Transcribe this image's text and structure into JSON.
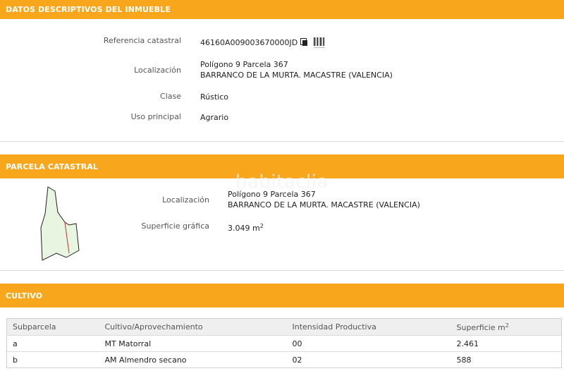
{
  "sections": {
    "descriptive": {
      "title": "DATOS DESCRIPTIVOS DEL INMUEBLE",
      "ref_label": "Referencia catastral",
      "ref_value": "46160A009003670000JD",
      "loc_label": "Localización",
      "loc_line1": "Polígono 9 Parcela 367",
      "loc_line2": "BARRANCO DE LA MURTA. MACASTRE (VALENCIA)",
      "clase_label": "Clase",
      "clase_value": "Rústico",
      "uso_label": "Uso principal",
      "uso_value": "Agrario"
    },
    "parcela": {
      "title": "PARCELA CATASTRAL",
      "loc_label": "Localización",
      "loc_line1": "Polígono 9 Parcela 367",
      "loc_line2": "BARRANCO DE LA MURTA. MACASTRE (VALENCIA)",
      "sup_label": "Superficie gráfica",
      "sup_value": "3.049 m",
      "sup_exp": "2",
      "watermark": "habitaclia"
    },
    "cultivo": {
      "title": "CULTIVO",
      "headers": [
        "Subparcela",
        "Cultivo/Aprovechamiento",
        "Intensidad Productiva",
        "Superficie m"
      ],
      "header_exp": "2",
      "rows": [
        [
          "a",
          "MT Matorral",
          "00",
          "2.461"
        ],
        [
          "b",
          "AM Almendro secano",
          "02",
          "588"
        ]
      ]
    }
  },
  "icons": {
    "copy": "copy-icon",
    "barcode": "barcode-icon"
  },
  "colors": {
    "header_bg": "#f8a61c",
    "header_text": "#ffffff",
    "parcel_fill": "#e8f5e0",
    "parcel_divider": "#cc3333"
  }
}
